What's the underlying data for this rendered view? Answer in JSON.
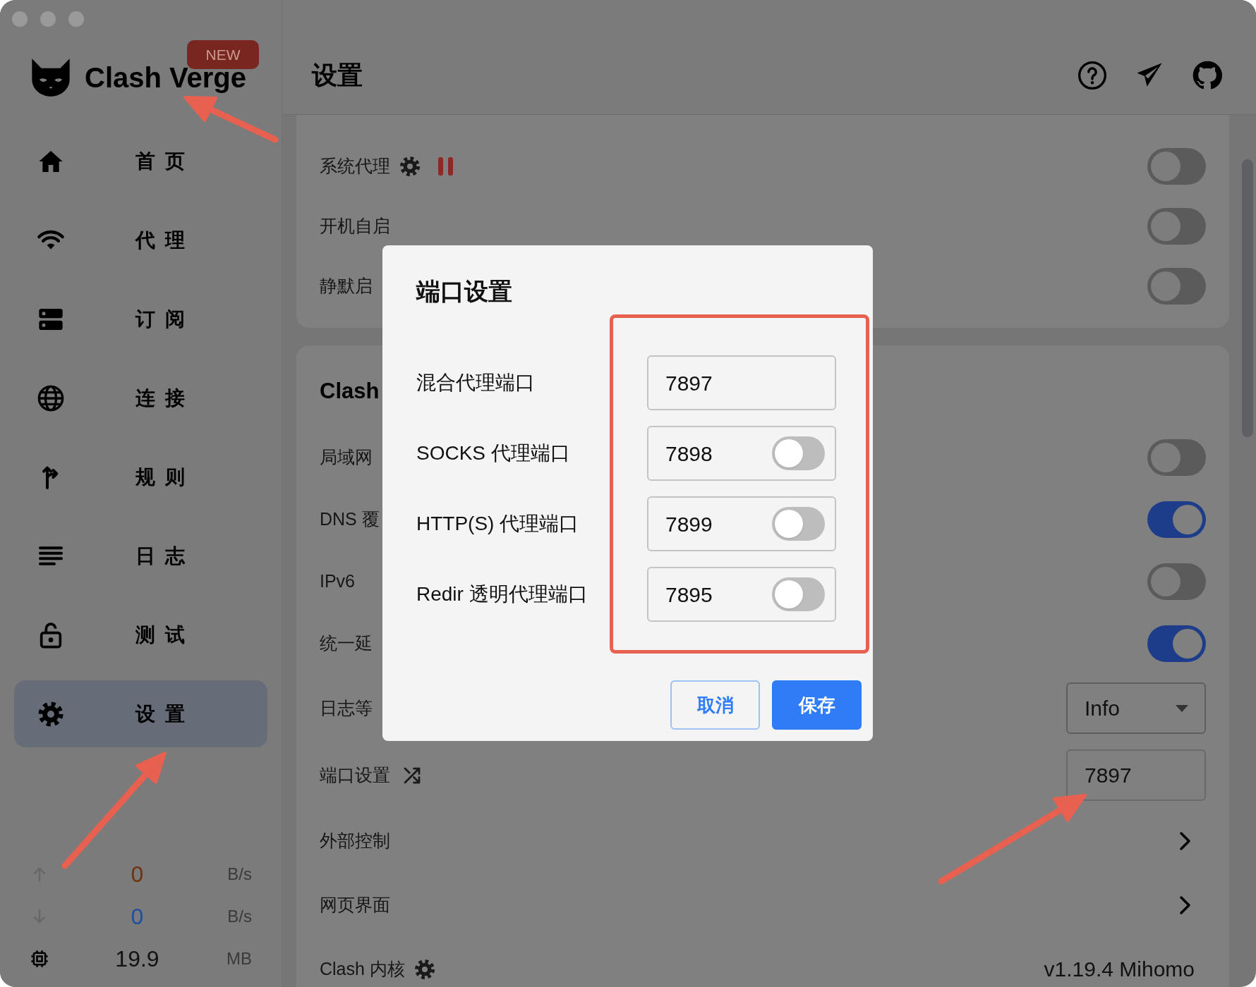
{
  "sidebar": {
    "app_name": "Clash Verge",
    "badge": "NEW",
    "items": [
      {
        "label": "首页",
        "kind": "home",
        "selected": false
      },
      {
        "label": "代理",
        "kind": "proxy",
        "selected": false
      },
      {
        "label": "订阅",
        "kind": "profiles",
        "selected": false
      },
      {
        "label": "连接",
        "kind": "connections",
        "selected": false
      },
      {
        "label": "规则",
        "kind": "rules",
        "selected": false
      },
      {
        "label": "日志",
        "kind": "logs",
        "selected": false
      },
      {
        "label": "测试",
        "kind": "test",
        "selected": false
      },
      {
        "label": "设置",
        "kind": "settings",
        "selected": true
      }
    ],
    "stats": [
      {
        "kind": "upload",
        "value": "0",
        "unit": "B/s",
        "color": "#6e3412"
      },
      {
        "kind": "download",
        "value": "0",
        "unit": "B/s",
        "color": "#1f4f9c"
      },
      {
        "kind": "memory",
        "value": "19.9",
        "unit": "MB",
        "color": "#111111"
      }
    ]
  },
  "header": {
    "title": "设置"
  },
  "sections": [
    {
      "rows": [
        {
          "kind": "toggle",
          "label": "系统代理",
          "has_gear": true,
          "paused": true,
          "on": false
        },
        {
          "kind": "toggle",
          "label": "开机自启",
          "on": false
        },
        {
          "kind": "toggle",
          "label": "静默启",
          "on": false
        }
      ]
    },
    {
      "title": "Clash",
      "rows": [
        {
          "kind": "toggle",
          "label": "局域网",
          "on": false
        },
        {
          "kind": "toggle",
          "label": "DNS 覆",
          "on": true
        },
        {
          "kind": "toggle",
          "label": "IPv6",
          "on": false
        },
        {
          "kind": "toggle",
          "label": "统一延",
          "on": true
        },
        {
          "kind": "select",
          "label": "日志等",
          "value": "Info"
        },
        {
          "kind": "port",
          "label": "端口设置",
          "has_shuffle": true,
          "value": "7897"
        },
        {
          "kind": "link",
          "label": "外部控制"
        },
        {
          "kind": "link",
          "label": "网页界面"
        },
        {
          "kind": "info",
          "label": "Clash 内核",
          "has_gear": true,
          "value": "v1.19.4 Mihomo"
        }
      ]
    }
  ],
  "dialog": {
    "title": "端口设置",
    "ports": [
      {
        "kind": "plain",
        "label": "混合代理端口",
        "value": "7897"
      },
      {
        "kind": "switch",
        "label": "SOCKS 代理端口",
        "value": "7898",
        "on": false
      },
      {
        "kind": "switch",
        "label": "HTTP(S) 代理端口",
        "value": "7899",
        "on": false
      },
      {
        "kind": "switch",
        "label": "Redir 透明代理端口",
        "value": "7895",
        "on": false
      }
    ],
    "buttons": [
      {
        "kind": "secondary",
        "label": "取消"
      },
      {
        "kind": "primary",
        "label": "保存"
      }
    ]
  }
}
